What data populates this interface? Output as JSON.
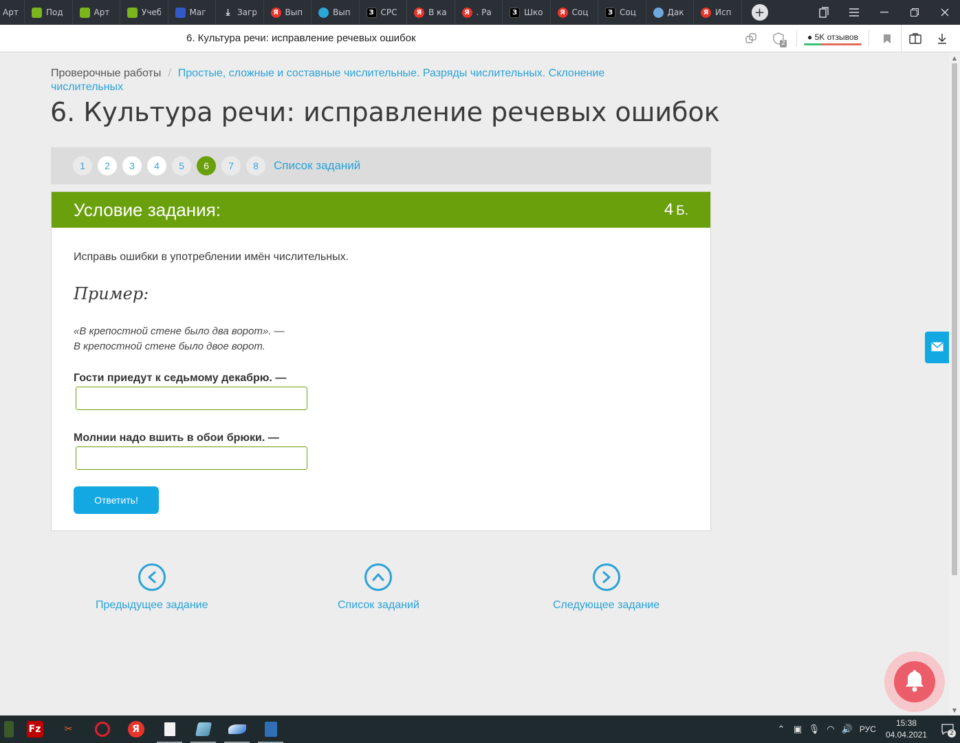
{
  "browser": {
    "tabs": [
      {
        "label": "Арт",
        "icon": "none"
      },
      {
        "label": "Под",
        "icon": "book"
      },
      {
        "label": "Арт",
        "icon": "book"
      },
      {
        "label": "Учеб",
        "icon": "book"
      },
      {
        "label": "Маг",
        "icon": "mag"
      },
      {
        "label": "Загр",
        "icon": "dl"
      },
      {
        "label": "Вып",
        "icon": "ya"
      },
      {
        "label": "Вып",
        "icon": "bulb"
      },
      {
        "label": "СРС",
        "icon": "z"
      },
      {
        "label": "В ка",
        "icon": "ya"
      },
      {
        "label": ". Ра",
        "icon": "ya"
      },
      {
        "label": "Шко",
        "icon": "z"
      },
      {
        "label": "Соц",
        "icon": "ya"
      },
      {
        "label": "Соц",
        "icon": "z"
      },
      {
        "label": "Дак",
        "icon": "cat"
      },
      {
        "label": "Исп",
        "icon": "ya"
      }
    ],
    "new_tab": "+",
    "page_title": "6. Культура речи: исправление речевых ошибок",
    "reviews_label": "5K отзывов",
    "tab_badge": "2"
  },
  "breadcrumb": {
    "root": "Проверочные работы",
    "separator": "/",
    "current": "Простые, сложные и составные числительные. Разряды числительных. Склонение числительных"
  },
  "page_title": "6. Культура речи: исправление речевых ошибок",
  "pager": {
    "pages": [
      "1",
      "2",
      "3",
      "4",
      "5",
      "6",
      "7",
      "8"
    ],
    "active": "6",
    "list_link": "Список заданий"
  },
  "task": {
    "header": "Условие задания:",
    "points_value": "4",
    "points_unit": "Б.",
    "instruction": "Исправь ошибки в употреблении имён числительных.",
    "example_heading": "Пример:",
    "example_line1": "«В крепостной стене было два ворот». —",
    "example_line2": "В крепостной стене было двое ворот.",
    "question1": "Гости приедут к седьмому декабрю. —",
    "answer1": "",
    "question2": "Молнии надо вшить в обои брюки. —",
    "answer2": "",
    "submit_label": "Ответить!"
  },
  "navigation": {
    "prev": "Предыдущее задание",
    "list": "Список заданий",
    "next": "Следующее задание"
  },
  "taskbar": {
    "language": "РУС",
    "time": "15:38",
    "date": "04.04.2021",
    "notifications": "2"
  },
  "colors": {
    "accent_green": "#6aa00b",
    "link_blue": "#2aa2d6",
    "button_blue": "#14a8e3",
    "bell_red": "#ec5d6a"
  }
}
